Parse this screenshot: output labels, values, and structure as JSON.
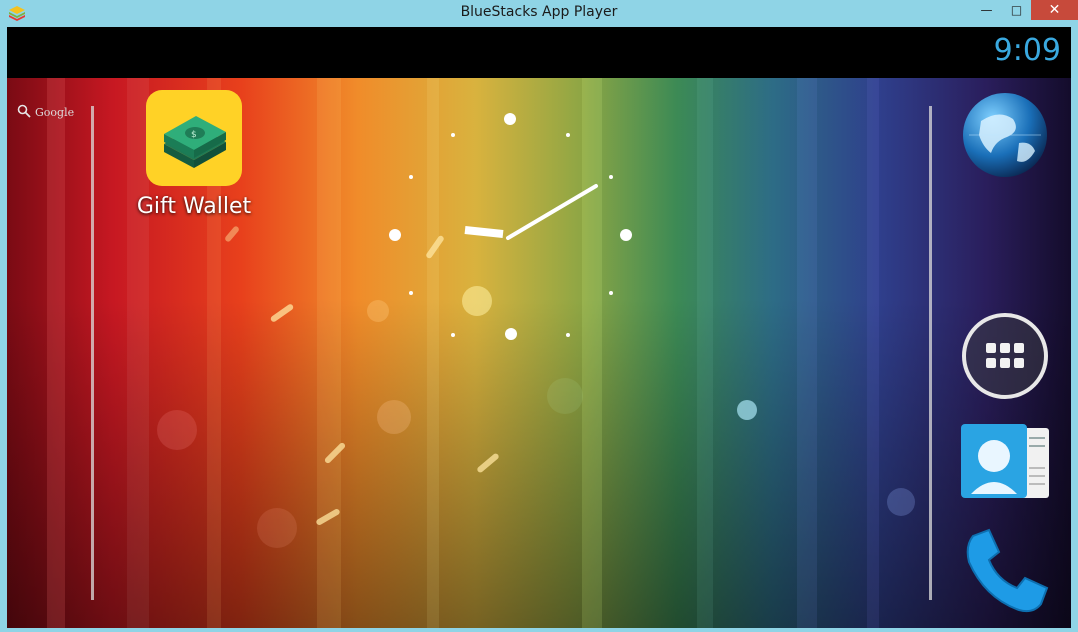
{
  "window": {
    "title": "BlueStacks App Player",
    "minimize_label": "—",
    "maximize_label": "□",
    "close_label": "✕"
  },
  "statusbar": {
    "time": "9:09",
    "time_color": "#3aa9e0"
  },
  "home": {
    "search_label": "Google",
    "apps": [
      {
        "label": "Gift Wallet",
        "icon": "money-stack-icon",
        "tile_color": "#ffd226"
      }
    ],
    "dock": [
      {
        "icon": "browser-globe-icon"
      },
      {
        "icon": "all-apps-icon"
      },
      {
        "icon": "contacts-icon"
      },
      {
        "icon": "phone-icon"
      }
    ]
  },
  "colors": {
    "titlebar": "#8fd4e6",
    "close_button": "#c74a3b",
    "accent": "#3aa9e0"
  }
}
